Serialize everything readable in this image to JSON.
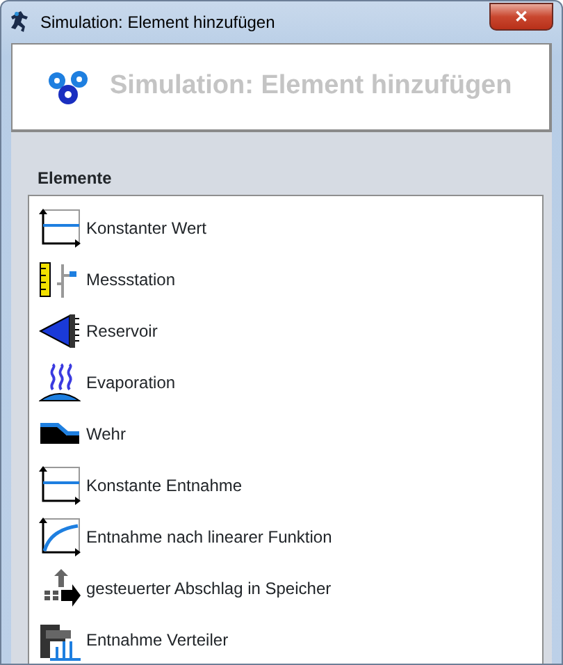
{
  "window": {
    "title": "Simulation: Element hinzufügen",
    "close_label": "✕"
  },
  "header": {
    "title": "Simulation: Element hinzufügen"
  },
  "group": {
    "label": "Elemente"
  },
  "elements": [
    {
      "label": "Konstanter Wert",
      "kind": "constant"
    },
    {
      "label": "Messstation",
      "kind": "gauge"
    },
    {
      "label": "Reservoir",
      "kind": "reservoir"
    },
    {
      "label": "Evaporation",
      "kind": "evaporation"
    },
    {
      "label": "Wehr",
      "kind": "weir"
    },
    {
      "label": "Konstante Entnahme",
      "kind": "constant"
    },
    {
      "label": "Entnahme nach linearer Funktion",
      "kind": "curve"
    },
    {
      "label": "gesteuerter Abschlag in Speicher",
      "kind": "arrow"
    },
    {
      "label": "Entnahme Verteiler",
      "kind": "tap"
    }
  ]
}
